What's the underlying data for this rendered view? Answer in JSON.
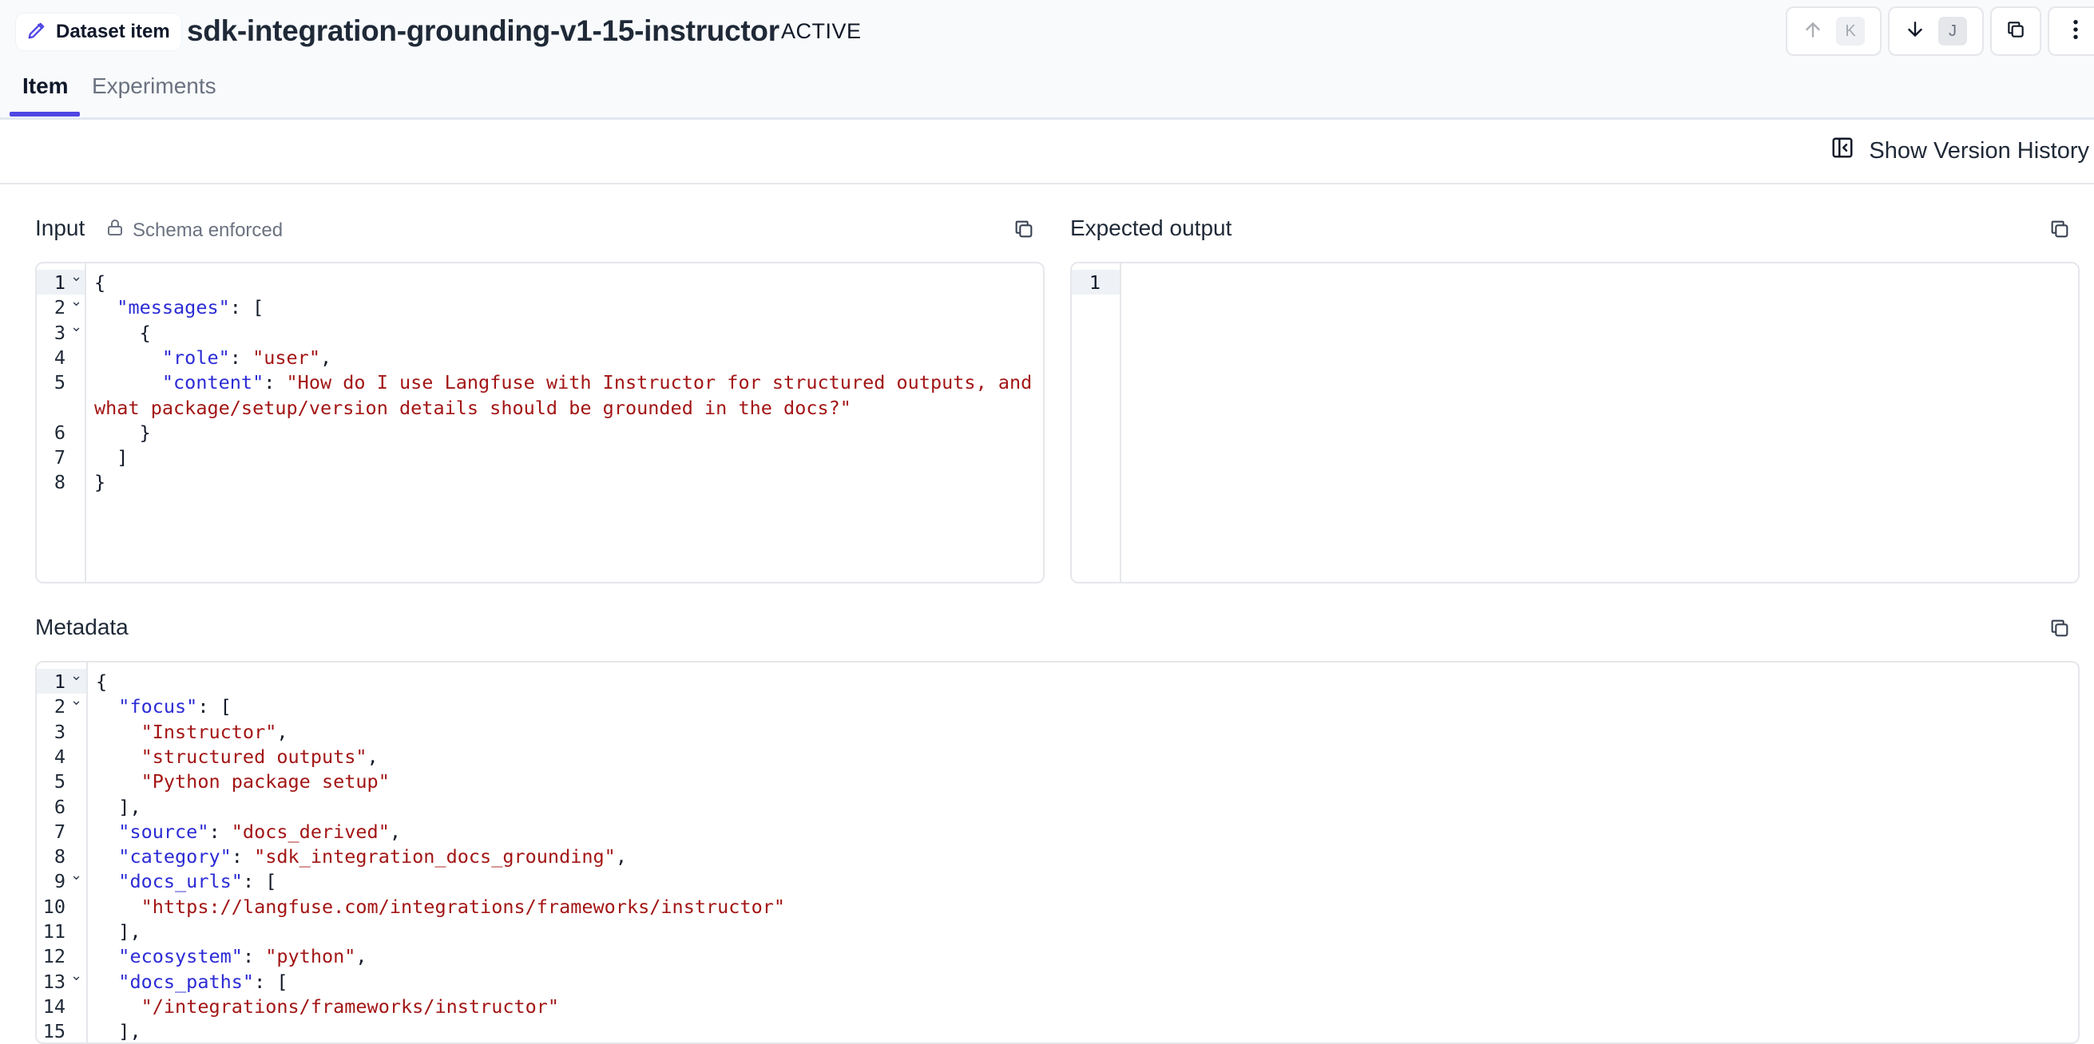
{
  "header": {
    "crumb_label": "Dataset item",
    "title": "sdk-integration-grounding-v1-15-instructor",
    "status": "ACTIVE",
    "prev_key": "K",
    "next_key": "J"
  },
  "tabs": [
    {
      "label": "Item",
      "active": true
    },
    {
      "label": "Experiments",
      "active": false
    }
  ],
  "version_history_label": "Show Version History",
  "input": {
    "label": "Input",
    "schema_label": "Schema enforced",
    "lines": [
      {
        "n": "1",
        "fold": true,
        "tokens": [
          [
            "p",
            "{"
          ]
        ]
      },
      {
        "n": "2",
        "fold": true,
        "tokens": [
          [
            "p",
            "  "
          ],
          [
            "k",
            "\"messages\""
          ],
          [
            "p",
            ": ["
          ]
        ]
      },
      {
        "n": "3",
        "fold": true,
        "tokens": [
          [
            "p",
            "    {"
          ]
        ]
      },
      {
        "n": "4",
        "fold": false,
        "tokens": [
          [
            "p",
            "      "
          ],
          [
            "k",
            "\"role\""
          ],
          [
            "p",
            ": "
          ],
          [
            "s",
            "\"user\""
          ],
          [
            "p",
            ","
          ]
        ]
      },
      {
        "n": "5",
        "fold": false,
        "tokens": [
          [
            "p",
            "      "
          ],
          [
            "k",
            "\"content\""
          ],
          [
            "p",
            ": "
          ],
          [
            "s",
            "\"How do I use Langfuse with Instructor for structured outputs, and"
          ]
        ]
      },
      {
        "n": "",
        "fold": false,
        "tokens": [
          [
            "s",
            "what package/setup/version details should be grounded in the docs?\""
          ]
        ]
      },
      {
        "n": "6",
        "fold": false,
        "tokens": [
          [
            "p",
            "    }"
          ]
        ]
      },
      {
        "n": "7",
        "fold": false,
        "tokens": [
          [
            "p",
            "  ]"
          ]
        ]
      },
      {
        "n": "8",
        "fold": false,
        "tokens": [
          [
            "p",
            "}"
          ]
        ]
      }
    ]
  },
  "expected_output": {
    "label": "Expected output",
    "lines": [
      {
        "n": "1",
        "fold": false,
        "tokens": []
      }
    ]
  },
  "metadata": {
    "label": "Metadata",
    "lines": [
      {
        "n": "1",
        "fold": true,
        "tokens": [
          [
            "p",
            "{"
          ]
        ]
      },
      {
        "n": "2",
        "fold": true,
        "tokens": [
          [
            "p",
            "  "
          ],
          [
            "k",
            "\"focus\""
          ],
          [
            "p",
            ": ["
          ]
        ]
      },
      {
        "n": "3",
        "fold": false,
        "tokens": [
          [
            "p",
            "    "
          ],
          [
            "s",
            "\"Instructor\""
          ],
          [
            "p",
            ","
          ]
        ]
      },
      {
        "n": "4",
        "fold": false,
        "tokens": [
          [
            "p",
            "    "
          ],
          [
            "s",
            "\"structured outputs\""
          ],
          [
            "p",
            ","
          ]
        ]
      },
      {
        "n": "5",
        "fold": false,
        "tokens": [
          [
            "p",
            "    "
          ],
          [
            "s",
            "\"Python package setup\""
          ]
        ]
      },
      {
        "n": "6",
        "fold": false,
        "tokens": [
          [
            "p",
            "  ],"
          ]
        ]
      },
      {
        "n": "7",
        "fold": false,
        "tokens": [
          [
            "p",
            "  "
          ],
          [
            "k",
            "\"source\""
          ],
          [
            "p",
            ": "
          ],
          [
            "s",
            "\"docs_derived\""
          ],
          [
            "p",
            ","
          ]
        ]
      },
      {
        "n": "8",
        "fold": false,
        "tokens": [
          [
            "p",
            "  "
          ],
          [
            "k",
            "\"category\""
          ],
          [
            "p",
            ": "
          ],
          [
            "s",
            "\"sdk_integration_docs_grounding\""
          ],
          [
            "p",
            ","
          ]
        ]
      },
      {
        "n": "9",
        "fold": true,
        "tokens": [
          [
            "p",
            "  "
          ],
          [
            "k",
            "\"docs_urls\""
          ],
          [
            "p",
            ": ["
          ]
        ]
      },
      {
        "n": "10",
        "fold": false,
        "tokens": [
          [
            "p",
            "    "
          ],
          [
            "s",
            "\"https://langfuse.com/integrations/frameworks/instructor\""
          ]
        ]
      },
      {
        "n": "11",
        "fold": false,
        "tokens": [
          [
            "p",
            "  ],"
          ]
        ]
      },
      {
        "n": "12",
        "fold": false,
        "tokens": [
          [
            "p",
            "  "
          ],
          [
            "k",
            "\"ecosystem\""
          ],
          [
            "p",
            ": "
          ],
          [
            "s",
            "\"python\""
          ],
          [
            "p",
            ","
          ]
        ]
      },
      {
        "n": "13",
        "fold": true,
        "tokens": [
          [
            "p",
            "  "
          ],
          [
            "k",
            "\"docs_paths\""
          ],
          [
            "p",
            ": ["
          ]
        ]
      },
      {
        "n": "14",
        "fold": false,
        "tokens": [
          [
            "p",
            "    "
          ],
          [
            "s",
            "\"/integrations/frameworks/instructor\""
          ]
        ]
      },
      {
        "n": "15",
        "fold": false,
        "tokens": [
          [
            "p",
            "  ],"
          ]
        ]
      }
    ]
  },
  "colors": {
    "accent": "#4f46e5",
    "json_key": "#2b2bd6",
    "json_string": "#a31515"
  },
  "icons": [
    "pencil-icon",
    "arrow-up-icon",
    "arrow-down-icon",
    "copy-icon",
    "more-vertical-icon",
    "panel-left-icon",
    "lock-icon",
    "chevron-down-icon"
  ]
}
